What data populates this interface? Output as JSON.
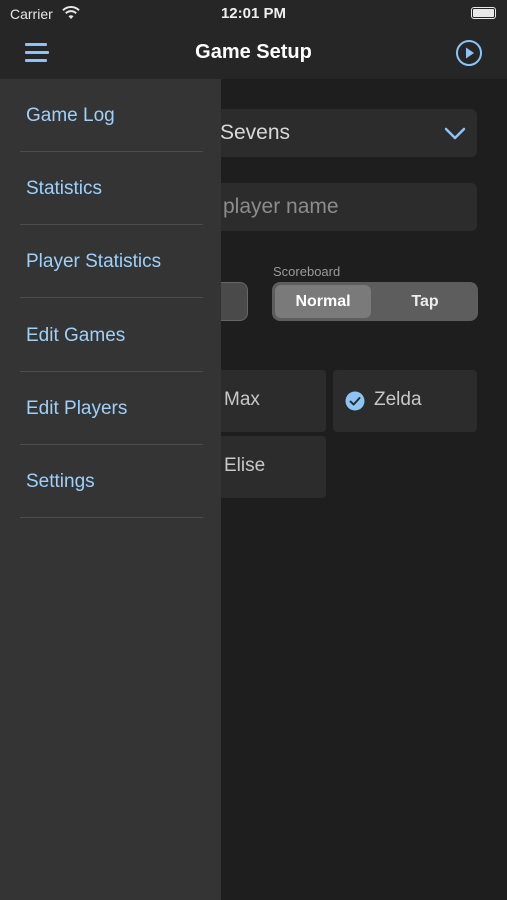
{
  "status_bar": {
    "carrier": "Carrier",
    "time": "12:01 PM"
  },
  "nav": {
    "title": "Game Setup",
    "menu_icon": "hamburger-menu-icon",
    "play_icon": "play-circle-icon"
  },
  "form": {
    "game_value": "Sevens",
    "player_name_placeholder": "player name",
    "scoreboard_label": "Scoreboard",
    "scoreboard_options": [
      "Normal",
      "Tap"
    ],
    "scoreboard_selected": "Normal",
    "players": [
      {
        "name": "Max",
        "checked": false
      },
      {
        "name": "Zelda",
        "checked": true
      },
      {
        "name": "Elise",
        "checked": false
      }
    ]
  },
  "drawer": {
    "items": [
      {
        "label": "Game Log"
      },
      {
        "label": "Statistics"
      },
      {
        "label": "Player Statistics"
      },
      {
        "label": "Edit Games"
      },
      {
        "label": "Edit Players"
      },
      {
        "label": "Settings"
      }
    ]
  },
  "colors": {
    "accent": "#9ed0fb",
    "drawer_bg": "#343434",
    "nav_bg": "#262626",
    "content_bg": "#1e1e1e"
  }
}
